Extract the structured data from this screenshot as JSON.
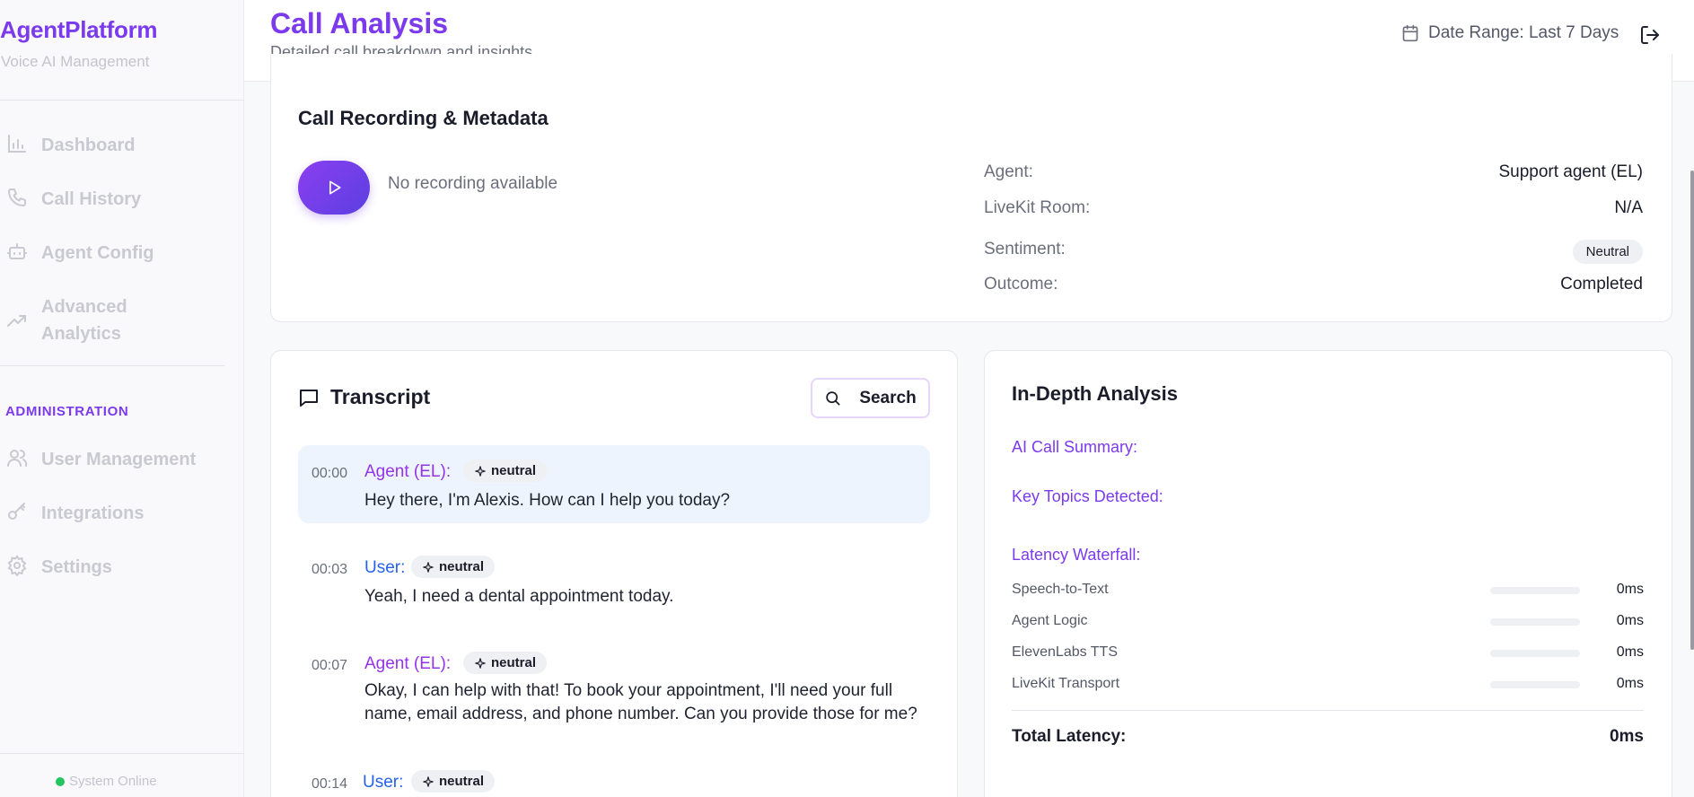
{
  "sidebar": {
    "brand": "AgentPlatform",
    "brand_sub": "Voice AI Management",
    "nav": [
      {
        "label": "Dashboard",
        "icon": "bar-chart-icon"
      },
      {
        "label": "Call History",
        "icon": "phone-icon"
      },
      {
        "label": "Agent Config",
        "icon": "bot-icon"
      },
      {
        "label": "Advanced Analytics",
        "icon": "trending-up-icon"
      }
    ],
    "admin_heading": "ADMINISTRATION",
    "admin_nav": [
      {
        "label": "User Management",
        "icon": "users-icon"
      },
      {
        "label": "Integrations",
        "icon": "key-icon"
      },
      {
        "label": "Settings",
        "icon": "gear-icon"
      }
    ],
    "status": "System Online"
  },
  "header": {
    "title": "Call Analysis",
    "subtitle": "Detailed call breakdown and insights",
    "date_range": "Date Range: Last 7 Days"
  },
  "metadata": {
    "title": "Call Recording & Metadata",
    "no_recording": "No recording available",
    "rows": [
      {
        "key": "Agent:",
        "value": "Support agent (EL)"
      },
      {
        "key": "LiveKit Room:",
        "value": "N/A"
      },
      {
        "key": "Sentiment:",
        "value": "Neutral"
      },
      {
        "key": "Outcome:",
        "value": "Completed"
      }
    ]
  },
  "transcript": {
    "title": "Transcript",
    "search_label": "Search",
    "messages": [
      {
        "time": "00:00",
        "speaker": "Agent (EL):",
        "sentiment": "neutral",
        "text": "Hey there, I'm Alexis. How can I help you today?"
      },
      {
        "time": "00:03",
        "speaker": "User:",
        "sentiment": "neutral",
        "text": "Yeah, I need a dental appointment today."
      },
      {
        "time": "00:07",
        "speaker": "Agent (EL):",
        "sentiment": "neutral",
        "text": "Okay, I can help with that! To book your appointment, I'll need your full name, email address, and phone number. Can you provide those for me?"
      },
      {
        "time": "00:14",
        "speaker": "User:",
        "sentiment": "neutral",
        "text": ""
      }
    ]
  },
  "analysis": {
    "title": "In-Depth Analysis",
    "summary_label": "AI Call Summary:",
    "topics_label": "Key Topics Detected:",
    "latency_label": "Latency Waterfall:",
    "latency": [
      {
        "name": "Speech-to-Text",
        "value": "0ms",
        "fraction": 0
      },
      {
        "name": "Agent Logic",
        "value": "0ms",
        "fraction": 0
      },
      {
        "name": "ElevenLabs TTS",
        "value": "0ms",
        "fraction": 0
      },
      {
        "name": "LiveKit Transport",
        "value": "0ms",
        "fraction": 0
      }
    ],
    "total_label": "Total Latency:",
    "total_value": "0ms"
  },
  "colors": {
    "accent": "#7c3aed",
    "agent": "#9333ea",
    "user": "#2563eb",
    "online": "#22c55e"
  }
}
